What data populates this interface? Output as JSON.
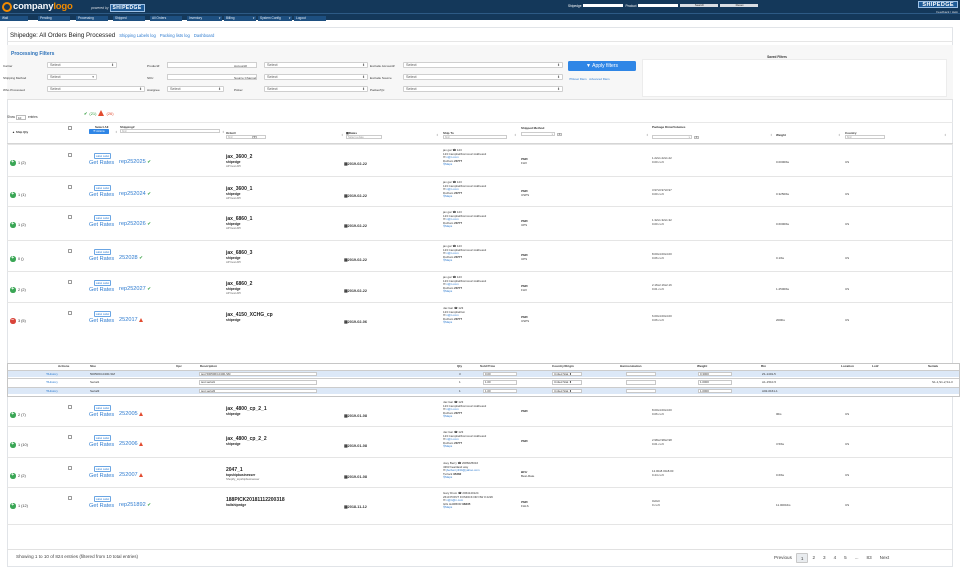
{
  "header": {
    "logo_part1": "company",
    "logo_part2": "logo",
    "powered_by": "powered by",
    "powered_brand": "SHIPEDGE",
    "shipedge_label": "Shipedge",
    "product_label": "Product",
    "search_btn": "Search",
    "reset_btn": "Reset",
    "brand_right": "SHIPEDGE",
    "feedback": "Feedback | Help"
  },
  "nav": {
    "tabs": [
      "Wall",
      "Pending",
      "Processing",
      "Shipped",
      "All Orders",
      "Inventory",
      "Billing",
      "System Config",
      "Logout"
    ],
    "current_user_line1": "Current User : gaboarlo",
    "current_user_line2": "Punch Card"
  },
  "title": {
    "text": "Shipedge: All Orders Being Processed",
    "links": [
      "Shipping Labels log",
      "Packing lists log",
      "Dashboard"
    ]
  },
  "filters": {
    "heading": "Processing Filters",
    "labels": {
      "carrier": "Carrier",
      "shipping_method": "Shipping Method",
      "who_processed": "Who Processed",
      "product": "Product#",
      "sku": "SKU",
      "assignee": "Assignee",
      "account": "Account#",
      "source_channel": "Source Channel",
      "picker": "Picker",
      "exclude_account": "Exclude Account#",
      "exclude_source": "Exclude Source",
      "packer_qc": "Packer/Qc"
    },
    "select_text": "Select",
    "apply_btn": "Apply filters",
    "reset_link": "Reset filters",
    "advanced_link": "Advanced filters",
    "saved_title": "Saved Filters"
  },
  "table": {
    "show_label": "Show",
    "show_value": "10",
    "entries_label": "entries",
    "ok_count": "(21)",
    "warn_count": "(26)",
    "headers": {
      "ship_qty": "Ship Qty",
      "select_all": "Select All",
      "actions": "Actions",
      "shipping": "Shipping#",
      "order": "Order#",
      "dates": "Dates",
      "ship_to": "Ship To",
      "shipped_method": "Shipped Method",
      "package": "Package Dims/Volumes",
      "weight": "Weight",
      "country": "Country"
    },
    "find_placeholder": "find",
    "select_date": "Select a date",
    "rows": [
      {
        "status": "g",
        "count": "1 (2)",
        "label": "Label Label",
        "getrates": "Get Rates",
        "shipping": "rep252025",
        "ship_ok": true,
        "order": "jax_3600_2",
        "store": "shipedge",
        "sub": "API test API",
        "date": "2019-02-22",
        "addr1": "jax gar",
        "phone": "123",
        "addr2": "123 CampbellKorncourt Address2",
        "email": "n@n.com",
        "city": "Durham",
        "zip": "23777",
        "maps": "Maps",
        "method": "PMD",
        "carrier": "FHX",
        "dims": "1.22x1.22x1.22",
        "vol": "0.00 cu ft",
        "weight": "0.0000lbs",
        "country": "US"
      },
      {
        "status": "g",
        "count": "1 (1)",
        "label": "Label Label",
        "getrates": "Get Rates",
        "shipping": "rep252024",
        "ship_ok": true,
        "order": "jax_3600_1",
        "store": "shipedge",
        "sub": "API test API",
        "date": "2019-02-22",
        "addr1": "jax gar",
        "phone": "123",
        "addr2": "123 CampbellKorncourt Address2",
        "email": "n@n.com",
        "city": "Durham",
        "zip": "23777",
        "maps": "Maps",
        "method": "PMD",
        "carrier": "USPS",
        "dims": "3.97x0.97x0.97",
        "vol": "0.00 cu ft",
        "weight": "0.3250lbs",
        "country": "US"
      },
      {
        "status": "g",
        "count": "1 (2)",
        "label": "Label Label",
        "getrates": "Get Rates",
        "shipping": "rep252026",
        "ship_ok": true,
        "order": "jax_6860_1",
        "store": "shipedge",
        "sub": "API test API",
        "date": "2019-02-22",
        "addr1": "jax gar",
        "phone": "123",
        "addr2": "123 CampbellKorncourt Address2",
        "email": "n@n.com",
        "city": "Durham",
        "zip": "23777",
        "maps": "Maps",
        "method": "PMD",
        "carrier": "UPS",
        "dims": "1.32x1.32x1.32",
        "vol": "0.00 cu ft",
        "weight": "0.6000lbs",
        "country": "US"
      },
      {
        "status": "g",
        "count": "0 ()",
        "label": "Label Label",
        "getrates": "Get Rates",
        "shipping": "252028",
        "ship_ok": true,
        "order": "jax_6860_3",
        "store": "shipedge",
        "sub": "API test API",
        "date": "2019-02-22",
        "addr1": "jax gar",
        "phone": "123",
        "addr2": "123 CampbellKorncourt Address2",
        "email": "n@n.com",
        "city": "Durham",
        "zip": "23777",
        "maps": "Maps",
        "method": "PMD",
        "carrier": "UPS",
        "dims": "8.00x4.00x4.00",
        "vol": "0.06 cu ft",
        "weight": "0.1lbs",
        "country": "US"
      },
      {
        "status": "g",
        "count": "2 (2)",
        "label": "Label Label",
        "getrates": "Get Rates",
        "shipping": "rep252027",
        "ship_ok": true,
        "order": "jax_6860_2",
        "store": "shipedge",
        "sub": "API test API",
        "date": "2019-02-22",
        "addr1": "jax gar",
        "phone": "123",
        "addr2": "123 CampbellKorncourt Address2",
        "email": "n@n.com",
        "city": "Durham",
        "zip": "23777",
        "maps": "Maps",
        "method": "PMD",
        "carrier": "FHX",
        "dims": "2.16x2.16x2.16",
        "vol": "0.01 cu ft",
        "weight": "1.2500lbs",
        "country": "US"
      },
      {
        "status": "r",
        "count": "3 (5)",
        "label": "Label Label",
        "getrates": "Get Rates",
        "shipping": "252017",
        "ship_ok": false,
        "order": "jax_4150_XCHG_cp",
        "store": "shipedge",
        "sub": "",
        "date": "2019-02-06",
        "addr1": "Jax Gar",
        "phone": "123",
        "addr2": "123 Campbellrun",
        "email": "n@n.com",
        "city": "Durham",
        "zip": "23777",
        "maps": "Maps",
        "method": "PMD",
        "carrier": "USPS",
        "dims": "6.00x4.00x4.00",
        "vol": "0.06 cu ft",
        "weight": "200lbs",
        "country": "US"
      },
      {
        "status": "g",
        "count": "2 (7)",
        "label": "Label Label",
        "getrates": "Get Rates",
        "shipping": "252005",
        "ship_ok": false,
        "order": "jax_4800_cp_2_1",
        "store": "shipedge",
        "sub": "",
        "date": "2019-01-08",
        "addr1": "Jax Gar",
        "phone": "123",
        "addr2": "123 CampbellKorncourt Address2",
        "email": "n@n.com",
        "city": "Durham",
        "zip": "23777",
        "maps": "Maps",
        "method": "PMD",
        "carrier": "",
        "dims": "8.00x4.00x4.00",
        "vol": "0.06 cu ft",
        "weight": "0lbs",
        "country": "US"
      },
      {
        "status": "g",
        "count": "1 (10)",
        "label": "Label Label",
        "getrates": "Get Rates",
        "shipping": "252006",
        "ship_ok": false,
        "order": "jax_4800_cp_2_2",
        "store": "shipedge",
        "sub": "",
        "date": "2019-01-08",
        "addr1": "Jax Gar",
        "phone": "123",
        "addr2": "123 CampbellKorncourt Address2",
        "email": "n@n.com",
        "city": "Durham",
        "zip": "23777",
        "maps": "Maps",
        "method": "PMD",
        "carrier": "",
        "dims": "2.98x2.98x2.98",
        "vol": "0.01 cu ft",
        "weight": "3.5lbs",
        "country": "US"
      },
      {
        "status": "g",
        "count": "2 (2)",
        "label": "Label Label",
        "getrates": "Get Rates",
        "shipping": "252007",
        "ship_ok": false,
        "order": "2047_1",
        "store": "topshipbusinesser",
        "sub": "Shopify_topshipbusinesser",
        "date": "2019-01-08",
        "addr1": "Joey Berry",
        "phone": "2086025016",
        "addr2": "4363 heartland way",
        "email": "jberberry334@yahoo.com",
        "city": "Turlock",
        "zip": "95382",
        "maps": "Maps",
        "method": "BFU",
        "carrier": "Best-Rate",
        "dims": "12.00x8.00x8.00",
        "vol": "0.44 cu ft",
        "weight": "0.6lbs",
        "country": "US"
      },
      {
        "status": "g",
        "count": "1 (12)",
        "label": "Label Label",
        "getrates": "Get Rates",
        "shipping": "rep251892",
        "ship_ok": true,
        "order": "188PICK20181112200318",
        "store": "hallshipedge",
        "sub": "",
        "date": "2018-11-12",
        "addr1": "Gary Drum",
        "phone": "2064140124",
        "addr2": "2610 POINT FOSDICK DR NW # 2226",
        "email": "n@n@n.com",
        "city": "GIG HARBOR",
        "zip": "98335",
        "maps": "Maps",
        "method": "PMD",
        "carrier": "FHLS",
        "dims": "0x0x0",
        "vol": "0 cu ft",
        "weight": "11.0001lbs",
        "country": "US"
      }
    ]
  },
  "subtable": {
    "headers": [
      "Actions",
      "Sku",
      "Upc",
      "Description",
      "Qty",
      "Sold Price",
      "Country/Origin",
      "Harmonization",
      "Weight",
      "Bin",
      "Location",
      "Lot#",
      "Serials"
    ],
    "history": "History",
    "rows": [
      {
        "sku": "5005063-0400-SM",
        "upc": "",
        "desc": "test 5005063-0400-SM",
        "qty": "3",
        "price": "0.00",
        "country": "United Stat",
        "harm": "",
        "weight": "0.3000",
        "bin": "Z1-1401-5",
        "location": "",
        "lot": "",
        "serials": ""
      },
      {
        "sku": "Serial1",
        "upc": "",
        "desc": "test serial1",
        "qty": "1",
        "price": "1.00",
        "country": "United Stat",
        "harm": "",
        "weight": "1.0000",
        "bin": "A1-1510-5",
        "location": "",
        "lot": "",
        "serials": "S1-1,S1-2,S1-3"
      },
      {
        "sku": "Serial3",
        "upc": "",
        "desc": "test serial3",
        "qty": "1",
        "price": "1.00",
        "country": "United Stat",
        "harm": "",
        "weight": "1.0000",
        "bin": "A02-0161-1",
        "location": "",
        "lot": "",
        "serials": ""
      }
    ]
  },
  "footer": {
    "showing": "Showing 1 to 10 of 824 entries (filtered from 10 total entries)",
    "pages": [
      "Previous",
      "1",
      "2",
      "3",
      "4",
      "5",
      "...",
      "83",
      "Next"
    ]
  },
  "colors": {
    "header_bg": "#14385a",
    "accent_blue": "#2f86e6",
    "link_blue": "#2f7cd0",
    "ok_green": "#3aa655",
    "warn_red": "#e24c30",
    "brand_orange": "#f08a00"
  }
}
